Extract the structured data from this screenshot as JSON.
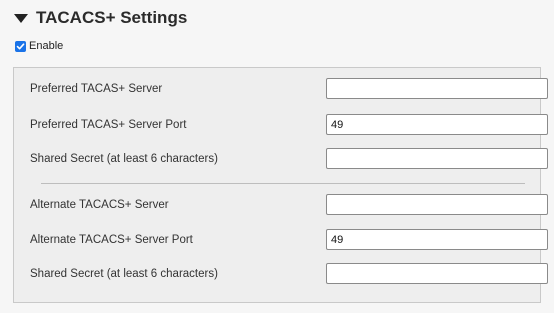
{
  "section": {
    "title": "TACACS+ Settings",
    "enable_label": "Enable"
  },
  "primary": {
    "server_label": "Preferred TACAS+ Server",
    "server_value": "",
    "port_label": "Preferred TACAS+ Server Port",
    "port_value": "49",
    "secret_label": "Shared Secret (at least 6 characters)",
    "secret_value": ""
  },
  "alternate": {
    "server_label": "Alternate TACACS+ Server",
    "server_value": "",
    "port_label": "Alternate TACACS+ Server Port",
    "port_value": "49",
    "secret_label": "Shared Secret (at least 6 characters)",
    "secret_value": ""
  },
  "colors": {
    "checkbox": "#1a73e8",
    "panel_bg": "#eeeeee"
  }
}
